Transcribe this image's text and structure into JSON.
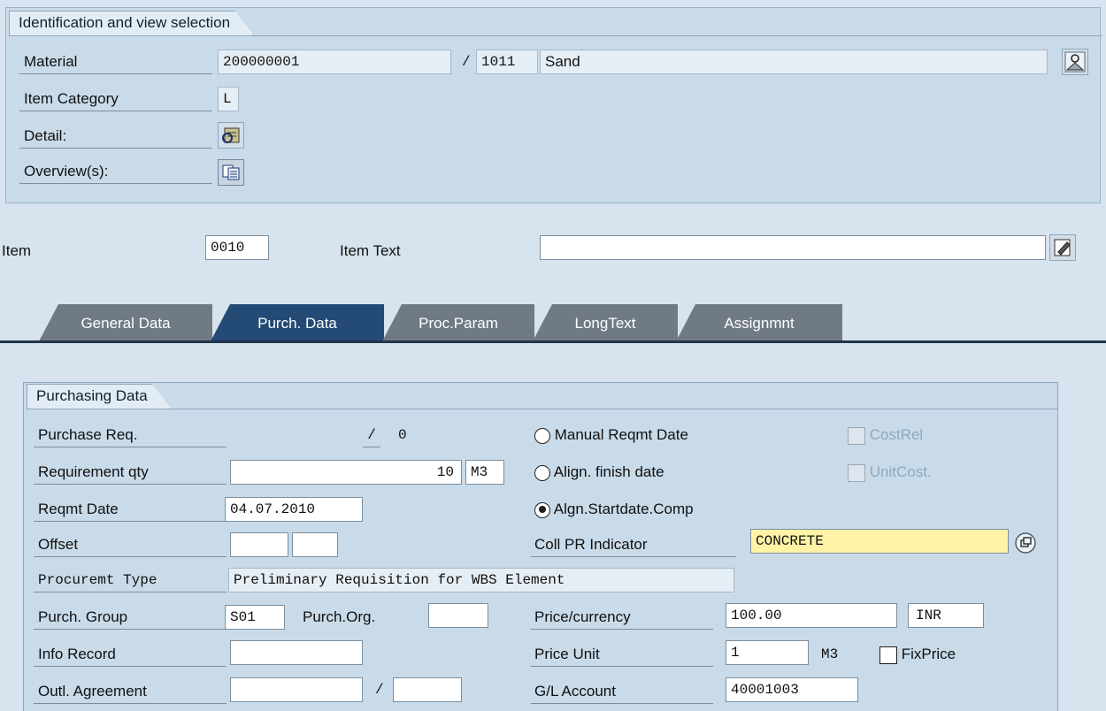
{
  "identification": {
    "group_title": "Identification and view selection",
    "material_label": "Material",
    "material_value": "200000001",
    "separator": "/",
    "plant_value": "1011",
    "material_desc": "Sand",
    "item_category_label": "Item Category",
    "item_category_value": "L",
    "detail_label": "Detail:",
    "overview_label": "Overview(s):",
    "icons": [
      "material-image-icon",
      "detail-icon",
      "overview-icon"
    ]
  },
  "item": {
    "item_label": "Item",
    "item_value": "0010",
    "item_text_label": "Item Text",
    "item_text_value": "",
    "icons": [
      "edit-text-icon"
    ]
  },
  "tabs": [
    {
      "label": "General Data",
      "active": false
    },
    {
      "label": "Purch. Data",
      "active": true
    },
    {
      "label": "Proc.Param",
      "active": false
    },
    {
      "label": "LongText",
      "active": false
    },
    {
      "label": "Assignmnt",
      "active": false
    }
  ],
  "purchasing": {
    "group_title": "Purchasing Data",
    "purchase_req_label": "Purchase Req.",
    "purchase_req_sep": "/",
    "purchase_req_value": "0",
    "req_qty_label": "Requirement qty",
    "req_qty_value": "10",
    "req_qty_unit": "M3",
    "reqmt_date_label": "Reqmt Date",
    "reqmt_date_value": "04.07.2010",
    "offset_label": "Offset",
    "proc_type_label": "Procuremt Type",
    "proc_type_value": "Preliminary Requisition for WBS Element",
    "purch_group_label": "Purch. Group",
    "purch_group_value": "S01",
    "purch_org_label": "Purch.Org.",
    "purch_org_value": "",
    "info_record_label": "Info Record",
    "info_record_value": "",
    "outl_agreement_label": "Outl. Agreement",
    "outl_agreement_sep": "/",
    "radio_manual": "Manual Reqmt Date",
    "radio_finish": "Align. finish date",
    "radio_start": "Algn.Startdate.Comp",
    "selected_radio": "Algn.Startdate.Comp",
    "costrel_label": "CostRel",
    "unitcost_label": "UnitCost.",
    "coll_pr_label": "Coll PR Indicator",
    "coll_pr_value": "CONCRETE",
    "price_label": "Price/currency",
    "price_value": "100.00",
    "currency_value": "INR",
    "price_unit_label": "Price Unit",
    "price_unit_value": "1",
    "price_unit_uom": "M3",
    "fixprice_label": "FixPrice",
    "gl_label": "G/L Account",
    "gl_value": "40001003",
    "icons": [
      "value-help-icon"
    ]
  },
  "colors": {
    "active_tab": "#244a76",
    "inactive_tab": "#6f7a84",
    "required_highlight": "#fff3a6",
    "panel_bg": "#c9dbe9"
  }
}
